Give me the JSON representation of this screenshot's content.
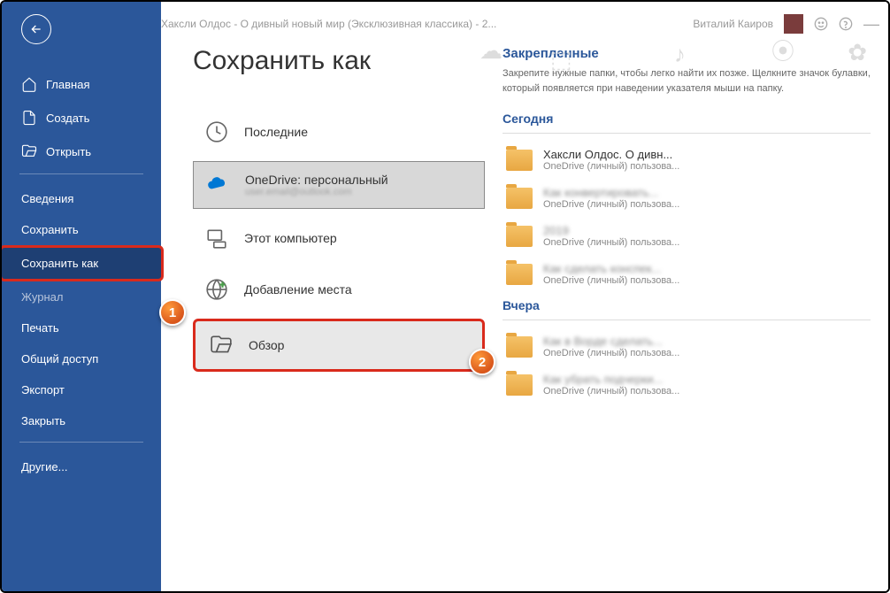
{
  "titlebar": {
    "doc_title": "Хаксли Олдос - О дивный новый мир (Эксклюзивная классика) - 2...",
    "username": "Виталий Каиров"
  },
  "sidebar": {
    "home": "Главная",
    "new": "Создать",
    "open": "Открыть",
    "info": "Сведения",
    "save": "Сохранить",
    "save_as": "Сохранить как",
    "history": "Журнал",
    "print": "Печать",
    "share": "Общий доступ",
    "export": "Экспорт",
    "close": "Закрыть",
    "more": "Другие..."
  },
  "page": {
    "title": "Сохранить как"
  },
  "locations": {
    "recent": "Последние",
    "onedrive": "OneDrive: персональный",
    "onedrive_sub": "user.email@outlook.com",
    "this_pc": "Этот компьютер",
    "add_place": "Добавление места",
    "browse": "Обзор"
  },
  "right": {
    "pinned_heading": "Закрепленные",
    "pinned_desc": "Закрепите нужные папки, чтобы легко найти их позже. Щелкните значок булавки, который появляется при наведении указателя мыши на папку.",
    "today": "Сегодня",
    "yesterday": "Вчера",
    "path": "OneDrive (личный) пользова...",
    "files": {
      "f1": "Хаксли Олдос. О дивн...",
      "f2": "Как конвертировать...",
      "f3": "2019",
      "f4": "Как сделать конспек...",
      "f5": "Как в Ворде сделать...",
      "f6": "Как убрать подчерки..."
    }
  },
  "badges": {
    "one": "1",
    "two": "2"
  }
}
